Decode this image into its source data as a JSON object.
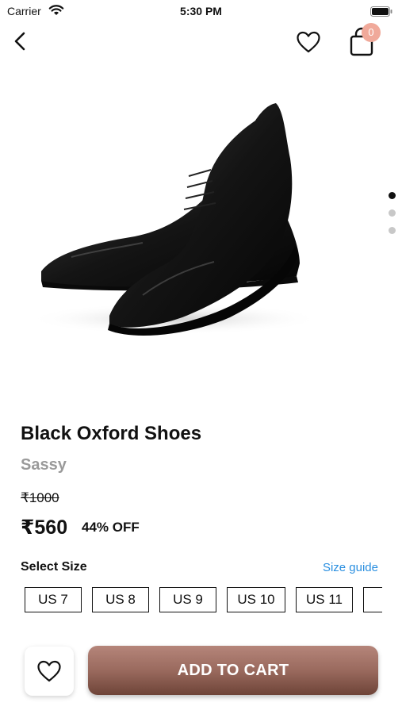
{
  "status_bar": {
    "carrier": "Carrier",
    "time": "5:30 PM"
  },
  "nav": {
    "bag_count": "0"
  },
  "product": {
    "title": "Black Oxford Shoes",
    "brand": "Sassy",
    "original_price": "₹1000",
    "price": "₹560",
    "discount": "44% OFF",
    "image_pages": 3,
    "active_page": 1
  },
  "sizes": {
    "label": "Select Size",
    "guide_label": "Size guide",
    "options": [
      "US 7",
      "US 8",
      "US 9",
      "US 10",
      "US 11",
      "U"
    ]
  },
  "actions": {
    "add_to_cart_label": "ADD TO CART"
  },
  "colors": {
    "accent": "#9a6a5e",
    "badge": "#f0a99a",
    "link": "#2a8fe0"
  }
}
